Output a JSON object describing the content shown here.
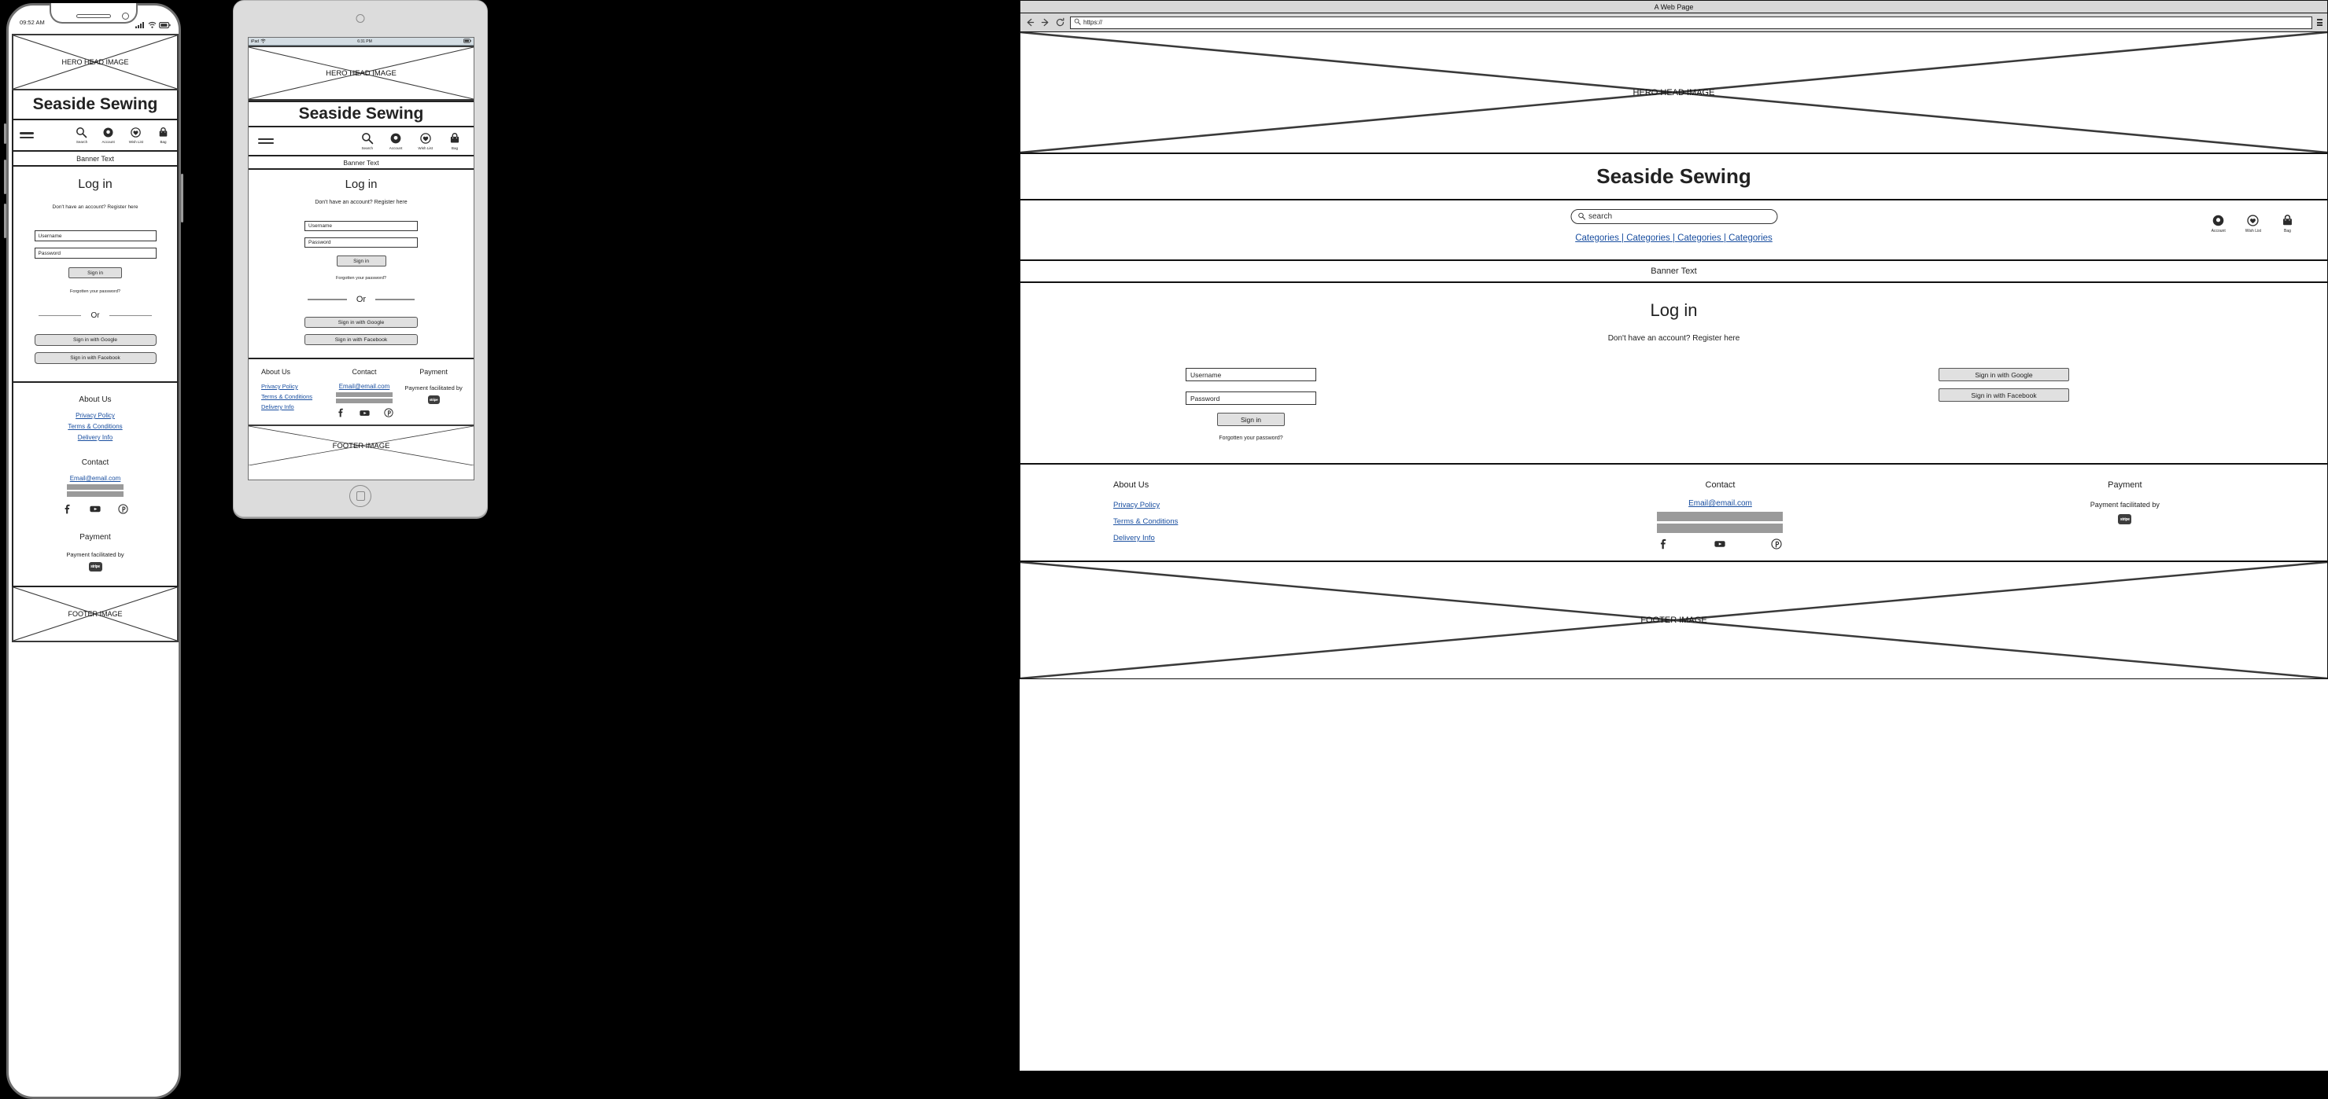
{
  "brand": {
    "name": "Seaside Sewing",
    "hero_image_label": "HERO HEAD IMAGE",
    "footer_image_label": "FOOTER IMAGE",
    "banner_text": "Banner Text"
  },
  "phone": {
    "status_time": "09:52 AM",
    "icons": [
      {
        "name": "search-icon",
        "label": "Search"
      },
      {
        "name": "account-icon",
        "label": "Account"
      },
      {
        "name": "wishlist-icon",
        "label": "Wish List"
      },
      {
        "name": "bag-icon",
        "label": "Bag"
      }
    ]
  },
  "tablet": {
    "status_device": "iPad",
    "status_time": "6:31 PM",
    "icons": [
      {
        "name": "search-icon",
        "label": "Search"
      },
      {
        "name": "account-icon",
        "label": "Account"
      },
      {
        "name": "wishlist-icon",
        "label": "Wish List"
      },
      {
        "name": "bag-icon",
        "label": "Bag"
      }
    ]
  },
  "desktop": {
    "window_title": "A Web Page",
    "url_value": "https://",
    "search_placeholder": "search",
    "categories_nav": "Categories | Categories | Categories | Categories",
    "icons": [
      {
        "name": "account-icon",
        "label": "Account"
      },
      {
        "name": "wishlist-icon",
        "label": "Wish List"
      },
      {
        "name": "bag-icon",
        "label": "Bag"
      }
    ]
  },
  "login": {
    "heading": "Log in",
    "register_prompt": "Don't have an account? Register here",
    "username_placeholder": "Username",
    "password_placeholder": "Password",
    "signin_label": "Sign in",
    "forgot_label": "Forgotten your password?",
    "divider_label": "Or",
    "google_label": "Sign in with Google",
    "facebook_label": "Sign in with Facebook"
  },
  "footer": {
    "about_heading": "About Us",
    "about_links": [
      "Privacy Policy",
      "Terms & Conditions",
      "Delivery Info"
    ],
    "contact_heading": "Contact",
    "contact_email": "Email@email.com",
    "payment_heading": "Payment",
    "payment_text": "Payment facilitated by",
    "payment_provider": "stripe",
    "social": [
      {
        "name": "facebook-icon",
        "glyph": "f"
      },
      {
        "name": "youtube-icon",
        "glyph": "▶"
      },
      {
        "name": "pinterest-icon",
        "glyph": "P"
      }
    ]
  },
  "colors": {
    "link": "#1a4fa0",
    "button_fill": "#e0e0e0",
    "greybar": "#9a9a9a",
    "stripe_badge": "#3d3d3d",
    "chrome": "#d8d8d8",
    "device_body": "#dcdcdc"
  }
}
